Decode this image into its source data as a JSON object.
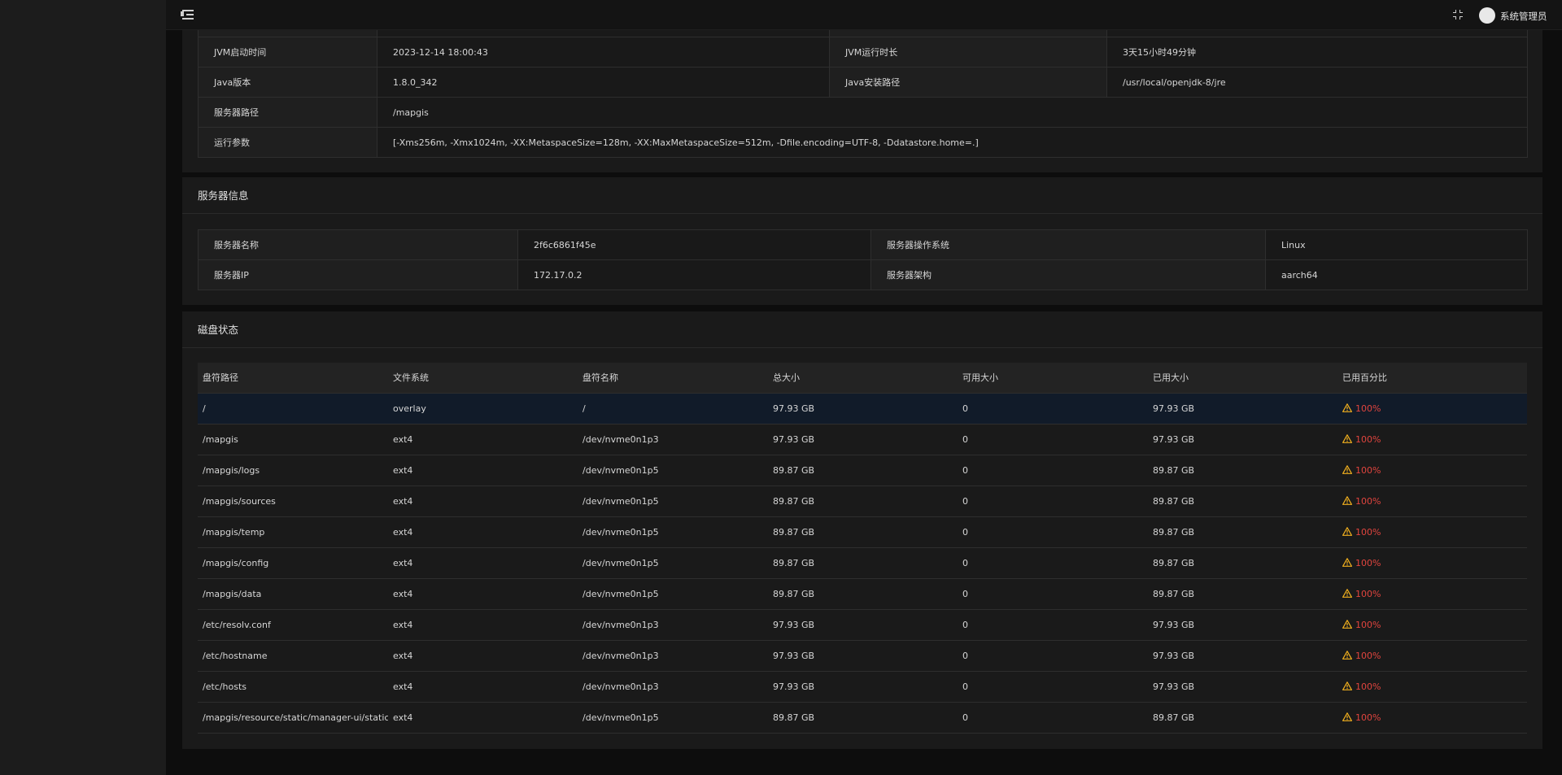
{
  "header": {
    "user_name": "系统管理员"
  },
  "jvm": {
    "rows": [
      {
        "label1": "JVM启动时间",
        "value1": "2023-12-14 18:00:43",
        "label2": "JVM运行时长",
        "value2": "3天15小时49分钟"
      },
      {
        "label1": "Java版本",
        "value1": "1.8.0_342",
        "label2": "Java安装路径",
        "value2": "/usr/local/openjdk-8/jre"
      }
    ],
    "server_path_label": "服务器路径",
    "server_path_value": "/mapgis",
    "run_args_label": "运行参数",
    "run_args_value": "[-Xms256m, -Xmx1024m, -XX:MetaspaceSize=128m, -XX:MaxMetaspaceSize=512m, -Dfile.encoding=UTF-8, -Ddatastore.home=.]"
  },
  "server": {
    "title": "服务器信息",
    "rows": [
      {
        "label1": "服务器名称",
        "value1": "2f6c6861f45e",
        "label2": "服务器操作系统",
        "value2": "Linux"
      },
      {
        "label1": "服务器IP",
        "value1": "172.17.0.2",
        "label2": "服务器架构",
        "value2": "aarch64"
      }
    ]
  },
  "disk": {
    "title": "磁盘状态",
    "columns": [
      "盘符路径",
      "文件系统",
      "盘符名称",
      "总大小",
      "可用大小",
      "已用大小",
      "已用百分比"
    ],
    "rows": [
      {
        "path": "/",
        "fs": "overlay",
        "name": "/",
        "total": "97.93 GB",
        "free": "0",
        "used": "97.93 GB",
        "percent": "100%"
      },
      {
        "path": "/mapgis",
        "fs": "ext4",
        "name": "/dev/nvme0n1p3",
        "total": "97.93 GB",
        "free": "0",
        "used": "97.93 GB",
        "percent": "100%"
      },
      {
        "path": "/mapgis/logs",
        "fs": "ext4",
        "name": "/dev/nvme0n1p5",
        "total": "89.87 GB",
        "free": "0",
        "used": "89.87 GB",
        "percent": "100%"
      },
      {
        "path": "/mapgis/sources",
        "fs": "ext4",
        "name": "/dev/nvme0n1p5",
        "total": "89.87 GB",
        "free": "0",
        "used": "89.87 GB",
        "percent": "100%"
      },
      {
        "path": "/mapgis/temp",
        "fs": "ext4",
        "name": "/dev/nvme0n1p5",
        "total": "89.87 GB",
        "free": "0",
        "used": "89.87 GB",
        "percent": "100%"
      },
      {
        "path": "/mapgis/config",
        "fs": "ext4",
        "name": "/dev/nvme0n1p5",
        "total": "89.87 GB",
        "free": "0",
        "used": "89.87 GB",
        "percent": "100%"
      },
      {
        "path": "/mapgis/data",
        "fs": "ext4",
        "name": "/dev/nvme0n1p5",
        "total": "89.87 GB",
        "free": "0",
        "used": "89.87 GB",
        "percent": "100%"
      },
      {
        "path": "/etc/resolv.conf",
        "fs": "ext4",
        "name": "/dev/nvme0n1p3",
        "total": "97.93 GB",
        "free": "0",
        "used": "97.93 GB",
        "percent": "100%"
      },
      {
        "path": "/etc/hostname",
        "fs": "ext4",
        "name": "/dev/nvme0n1p3",
        "total": "97.93 GB",
        "free": "0",
        "used": "97.93 GB",
        "percent": "100%"
      },
      {
        "path": "/etc/hosts",
        "fs": "ext4",
        "name": "/dev/nvme0n1p3",
        "total": "97.93 GB",
        "free": "0",
        "used": "97.93 GB",
        "percent": "100%"
      },
      {
        "path": "/mapgis/resource/static/manager-ui/static",
        "fs": "ext4",
        "name": "/dev/nvme0n1p5",
        "total": "89.87 GB",
        "free": "0",
        "used": "89.87 GB",
        "percent": "100%"
      }
    ]
  },
  "icons": {
    "menu": "menu-fold-icon",
    "fullscreen": "fullscreen-icon",
    "warning": "warning-icon"
  },
  "colors": {
    "percent_text": "#e0443e",
    "warning_icon": "#f2b01e",
    "highlight_row": "#111b29"
  }
}
